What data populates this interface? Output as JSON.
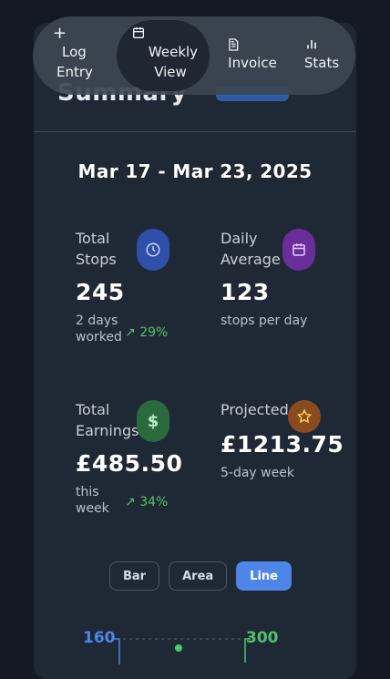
{
  "date_range": "Mar 17 - Mar 23, 2025",
  "nav": {
    "items": [
      {
        "label_line1": "Log",
        "label_line2": "Entry",
        "icon": "plus-icon"
      },
      {
        "label_line1": "Weekly",
        "label_line2": "View",
        "icon": "calendar-icon"
      },
      {
        "label_line1": "Invoice",
        "label_line2": "",
        "icon": "document-icon"
      },
      {
        "label_line1": "Stats",
        "label_line2": "",
        "icon": "bar-chart-icon"
      }
    ],
    "active": "Weekly View"
  },
  "stats": {
    "total_stops": {
      "label_line1": "Total",
      "label_line2": "Stops",
      "value": "245",
      "sub_line1": "2 days",
      "sub_line2": "worked",
      "trend": "29%",
      "icon": "clock-icon",
      "color": "#2f4fa8"
    },
    "daily_average": {
      "label_line1": "Daily",
      "label_line2": "Average",
      "value": "123",
      "sub_line1": "stops per day",
      "icon": "calendar-icon",
      "color": "#6a2e9a"
    },
    "total_earnings": {
      "label_line1": "Total",
      "label_line2": "Earnings",
      "value": "£485.50",
      "sub_line1": "this",
      "sub_line2": "week",
      "trend": "34%",
      "icon": "dollar-icon",
      "color": "#2b6a3e"
    },
    "projected": {
      "label_line1": "Projected",
      "value": "£1213.75",
      "sub_line1": "5-day week",
      "icon": "star-icon",
      "color": "#8a4b1e"
    }
  },
  "chart_type_buttons": [
    {
      "label": "Bar",
      "active": false
    },
    {
      "label": "Area",
      "active": false
    },
    {
      "label": "Line",
      "active": true
    }
  ],
  "chart_axes": {
    "left_top": "160",
    "right_top": "300",
    "left_color": "#4d86e8",
    "right_color": "#4fc26b"
  }
}
